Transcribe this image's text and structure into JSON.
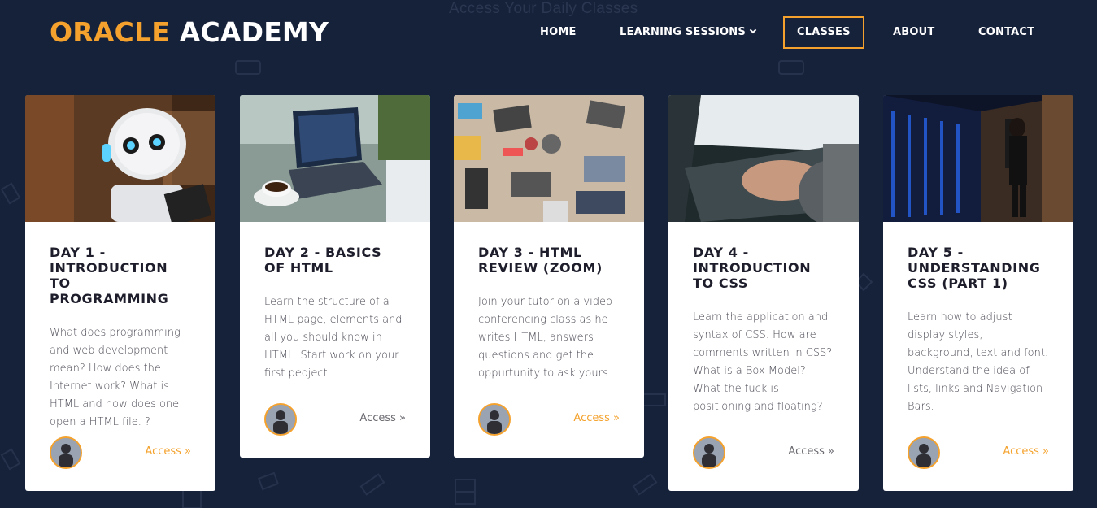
{
  "background": {
    "ghost_title": "Access Your Daily Classes"
  },
  "brand": {
    "part1": "ORACLE",
    "part2": "ACADEMY",
    "accent": "#f4a22d"
  },
  "nav": {
    "items": [
      {
        "label": "HOME"
      },
      {
        "label": "LEARNING SESSIONS",
        "icon": "chevron-down-icon"
      },
      {
        "label": "CLASSES",
        "active": true
      },
      {
        "label": "ABOUT"
      },
      {
        "label": "CONTACT"
      }
    ]
  },
  "cards": [
    {
      "title": "DAY 1 - INTRODUCTION TO PROGRAMMING",
      "desc": "What does programming and web development mean? How does the Internet work? What is HTML and how does one open a HTML file. ?",
      "access": "Access »",
      "access_color": "orange",
      "image": "robot"
    },
    {
      "title": "DAY 2 - BASICS OF HTML",
      "desc": "Learn the structure of a HTML page, elements and all you should know in HTML. Start work on your first peoject.",
      "access": "Access »",
      "access_color": "grey",
      "image": "laptop-coffee"
    },
    {
      "title": "DAY 3 - HTML REVIEW (ZOOM)",
      "desc": "Join your tutor on a video conferencing class as he writes HTML, answers questions and get the oppurtunity to ask yours.",
      "access": "Access »",
      "access_color": "orange",
      "image": "desk-top"
    },
    {
      "title": "DAY 4 - INTRODUCTION TO CSS",
      "desc": "Learn the application and syntax of CSS. How are comments written in CSS? What is a Box Model? What the fuck is positioning and floating?",
      "access": "Access »",
      "access_color": "grey",
      "image": "typing"
    },
    {
      "title": "DAY 5 - UNDERSTANDING CSS (PART 1)",
      "desc": "Learn how to adjust display styles, background, text and font. Understand the idea of lists, links and Navigation Bars.",
      "access": "Access »",
      "access_color": "orange",
      "image": "server-room"
    }
  ]
}
